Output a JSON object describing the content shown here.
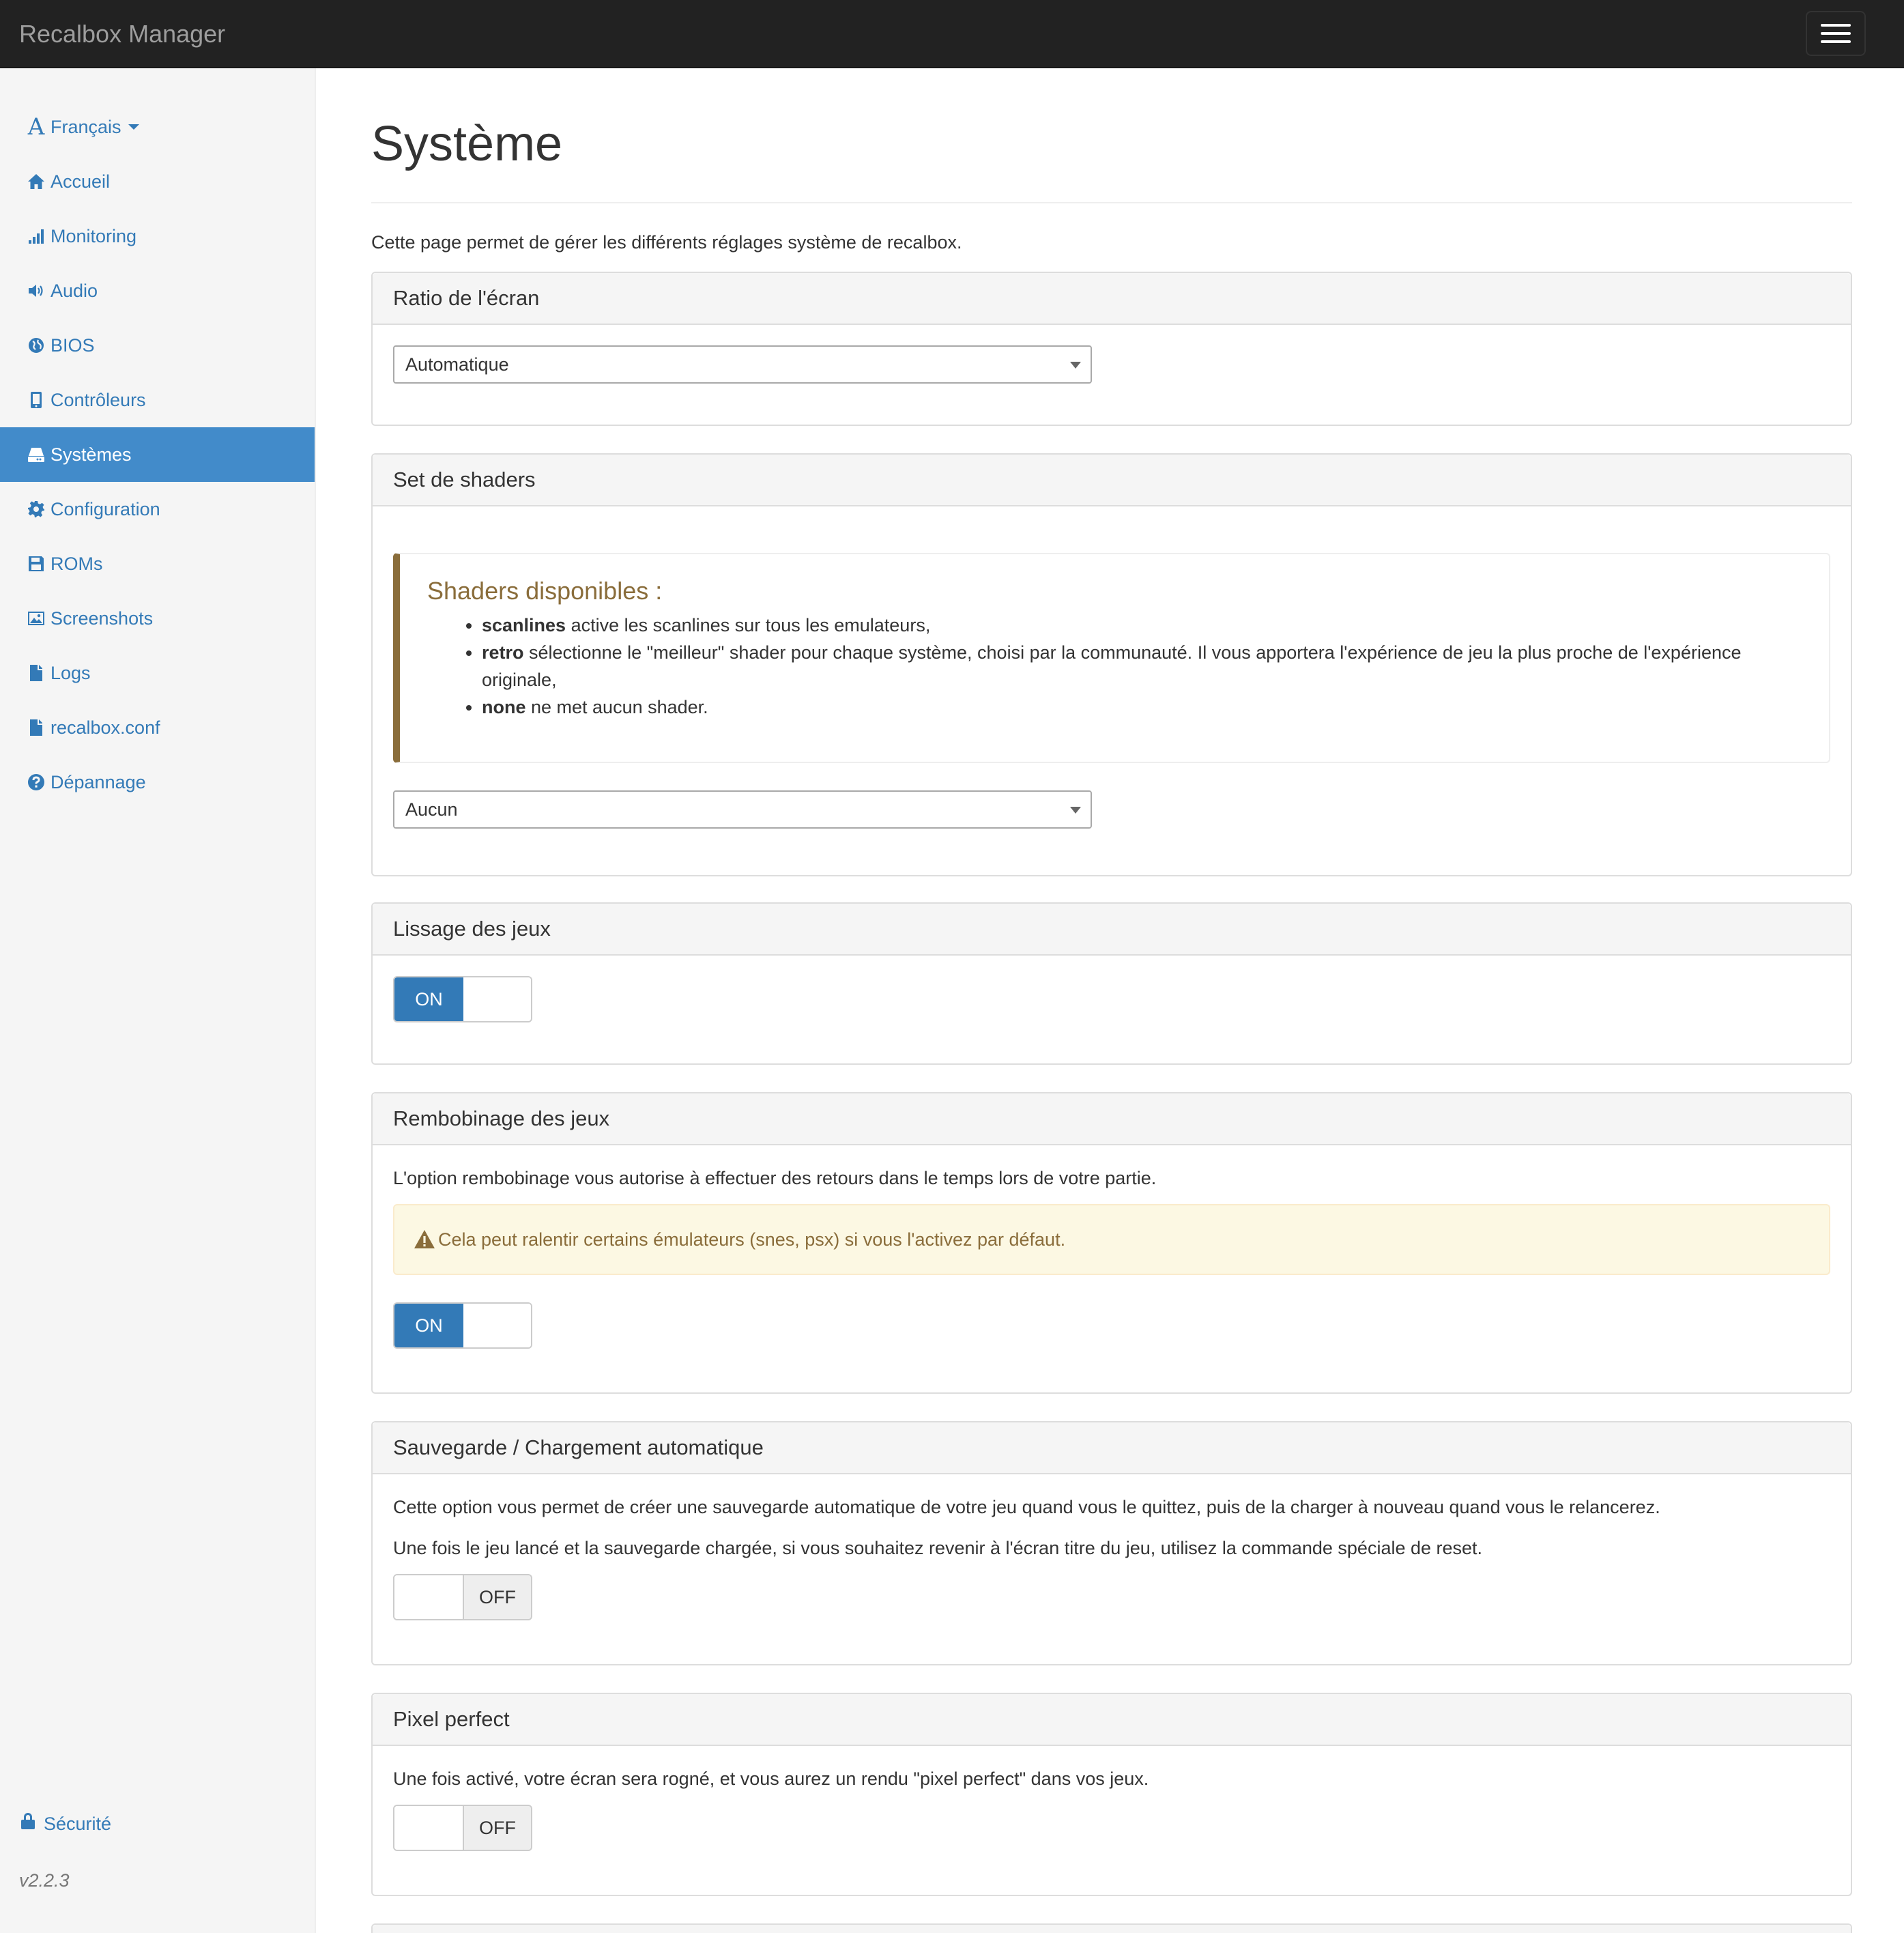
{
  "navbar": {
    "brand": "Recalbox Manager"
  },
  "sidebar": {
    "language": "Français",
    "items": [
      {
        "label": "Accueil",
        "icon": "home-icon"
      },
      {
        "label": "Monitoring",
        "icon": "signal-bars-icon"
      },
      {
        "label": "Audio",
        "icon": "volume-icon"
      },
      {
        "label": "BIOS",
        "icon": "globe-icon"
      },
      {
        "label": "Contrôleurs",
        "icon": "phone-icon"
      },
      {
        "label": "Systèmes",
        "icon": "hdd-icon",
        "active": true
      },
      {
        "label": "Configuration",
        "icon": "gear-icon"
      },
      {
        "label": "ROMs",
        "icon": "floppy-disk-icon"
      },
      {
        "label": "Screenshots",
        "icon": "picture-icon"
      },
      {
        "label": "Logs",
        "icon": "file-icon"
      },
      {
        "label": "recalbox.conf",
        "icon": "file-icon"
      },
      {
        "label": "Dépannage",
        "icon": "question-circle-icon"
      }
    ],
    "security": "Sécurité",
    "version": "v2.2.3"
  },
  "main": {
    "title": "Système",
    "intro": "Cette page permet de gérer les différents réglages système de recalbox.",
    "ratio": {
      "heading": "Ratio de l'écran",
      "selected": "Automatique"
    },
    "shaders": {
      "heading": "Set de shaders",
      "callout_title": "Shaders disponibles :",
      "items": [
        {
          "term": "scanlines",
          "desc": " active les scanlines sur tous les emulateurs,"
        },
        {
          "term": "retro",
          "desc": " sélectionne le \"meilleur\" shader pour chaque système, choisi par la communauté. Il vous apportera l'expérience de jeu la plus proche de l'expérience originale,"
        },
        {
          "term": "none",
          "desc": " ne met aucun shader."
        }
      ],
      "selected": "Aucun"
    },
    "smoothing": {
      "heading": "Lissage des jeux",
      "state": "ON"
    },
    "rewind": {
      "heading": "Rembobinage des jeux",
      "description": "L'option rembobinage vous autorise à effectuer des retours dans le temps lors de votre partie.",
      "warning": "Cela peut ralentir certains émulateurs (snes, psx) si vous l'activez par défaut.",
      "state": "ON"
    },
    "autosave": {
      "heading": "Sauvegarde / Chargement automatique",
      "line1": "Cette option vous permet de créer une sauvegarde automatique de votre jeu quand vous le quittez, puis de la charger à nouveau quand vous le relancerez.",
      "line2": "Une fois le jeu lancé et la sauvegarde chargée, si vous souhaitez revenir à l'écran titre du jeu, utilisez la commande spéciale de reset.",
      "state": "OFF"
    },
    "pixel_perfect": {
      "heading": "Pixel perfect",
      "description": "Une fois activé, votre écran sera rogné, et vous aurez un rendu \"pixel perfect\" dans vos jeux.",
      "state": "OFF"
    }
  },
  "colors": {
    "accent": "#337ab7",
    "active_bg": "#428bca",
    "warning_text": "#8a6d3b",
    "warning_bg": "#fcf8e3"
  }
}
